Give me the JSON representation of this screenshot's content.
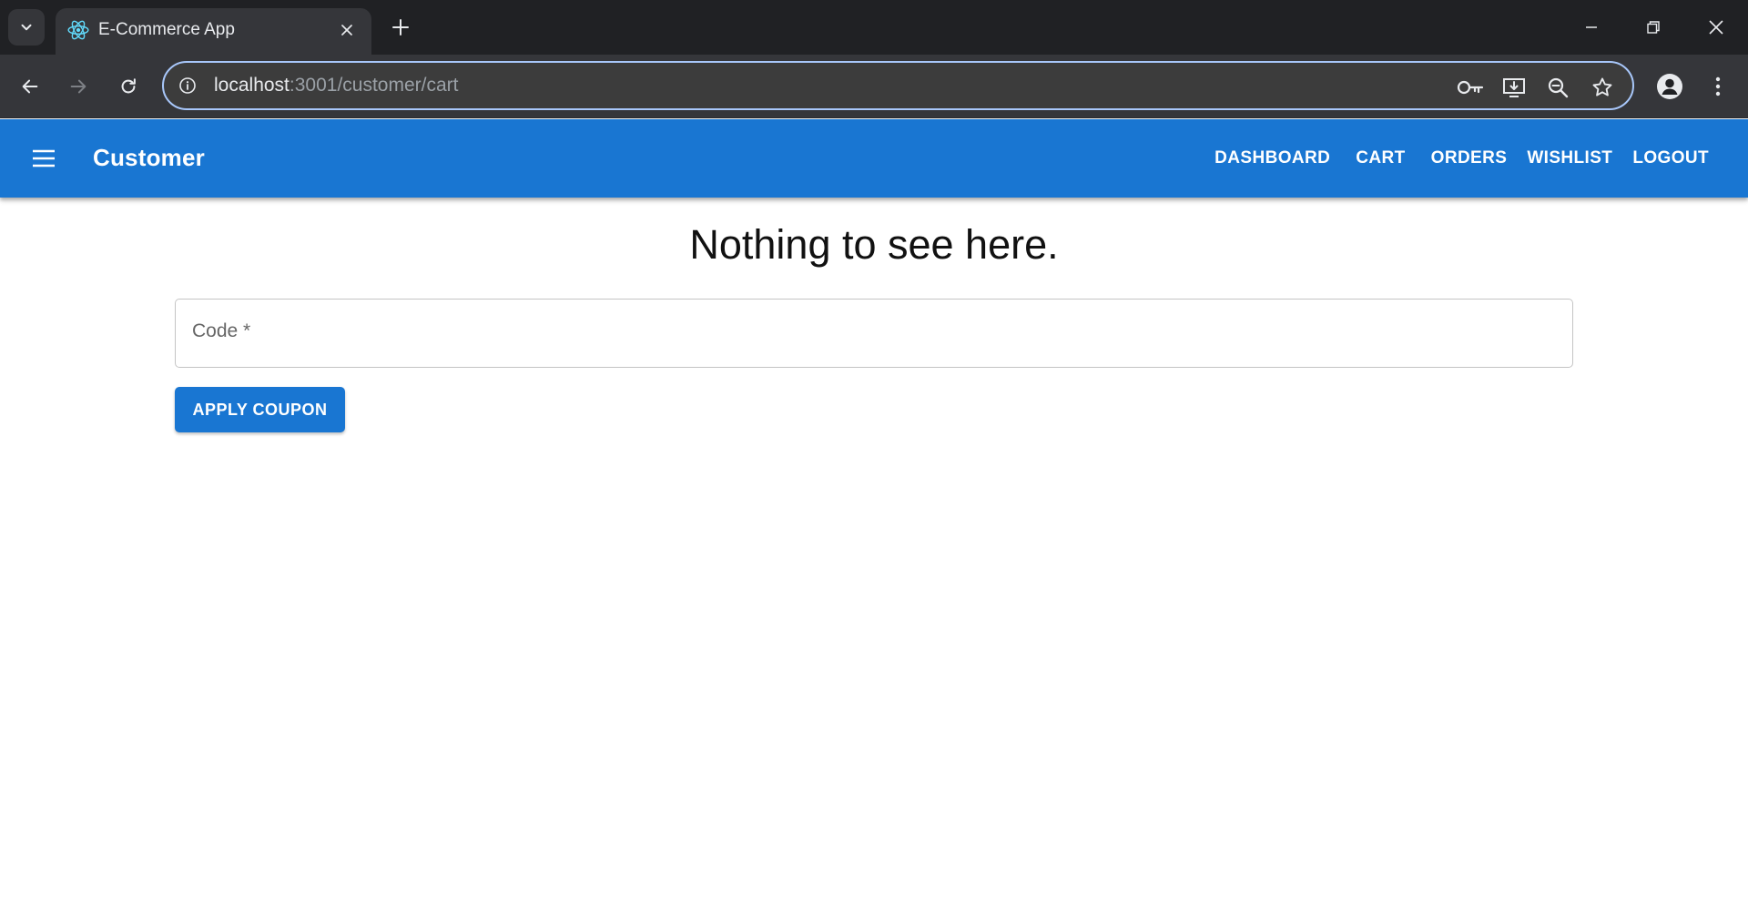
{
  "browser": {
    "tab_title": "E-Commerce App",
    "url_host": "localhost",
    "url_rest": ":3001/customer/cart"
  },
  "appbar": {
    "brand": "Customer",
    "color": "#1976d2",
    "nav": [
      "DASHBOARD",
      "CART",
      "ORDERS",
      "WISHLIST",
      "LOGOUT"
    ]
  },
  "main": {
    "empty_message": "Nothing to see here.",
    "code_label": "Code *",
    "apply_button": "APPLY COUPON"
  },
  "icons": {
    "tab_favicon": "react-icon",
    "omnibox": [
      "key-icon",
      "install-app-icon",
      "zoom-icon",
      "star-icon"
    ]
  }
}
